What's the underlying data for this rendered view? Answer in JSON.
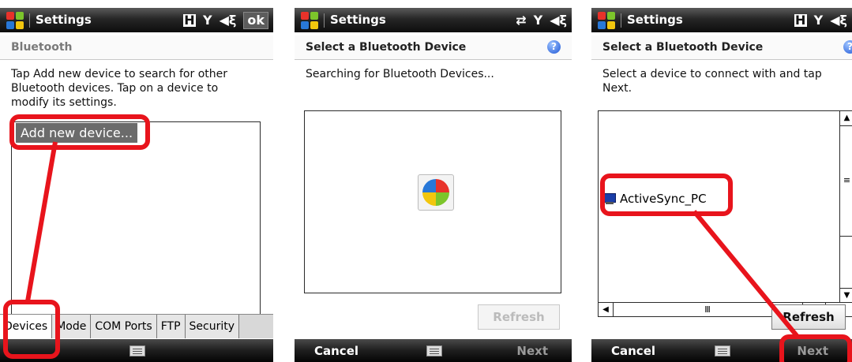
{
  "panels": {
    "bluetooth": {
      "title": "Settings",
      "ok_label": "ok",
      "header": "Bluetooth",
      "instructions": "Tap Add new device to search for other Bluetooth devices. Tap on a device to modify its settings.",
      "list_item": "Add new device...",
      "tabs": [
        "Devices",
        "Mode",
        "COM Ports",
        "FTP",
        "Security"
      ]
    },
    "searching": {
      "title": "Settings",
      "header": "Select a Bluetooth Device",
      "status": "Searching for Bluetooth Devices...",
      "refresh_label": "Refresh",
      "left_soft": "Cancel",
      "right_soft": "Next"
    },
    "select": {
      "title": "Settings",
      "header": "Select a Bluetooth Device",
      "instructions": "Select a device to connect with and tap Next.",
      "device": "ActiveSync_PC",
      "refresh_label": "Refresh",
      "left_soft": "Cancel",
      "right_soft": "Next"
    }
  },
  "icons": {
    "help": "?",
    "keyboard": "keyboard-icon",
    "h_indicator": "H",
    "signal": "Y",
    "volume": "◀"
  },
  "colors": {
    "highlight": "#e8141c",
    "title_bar": "#1a1a1a"
  }
}
